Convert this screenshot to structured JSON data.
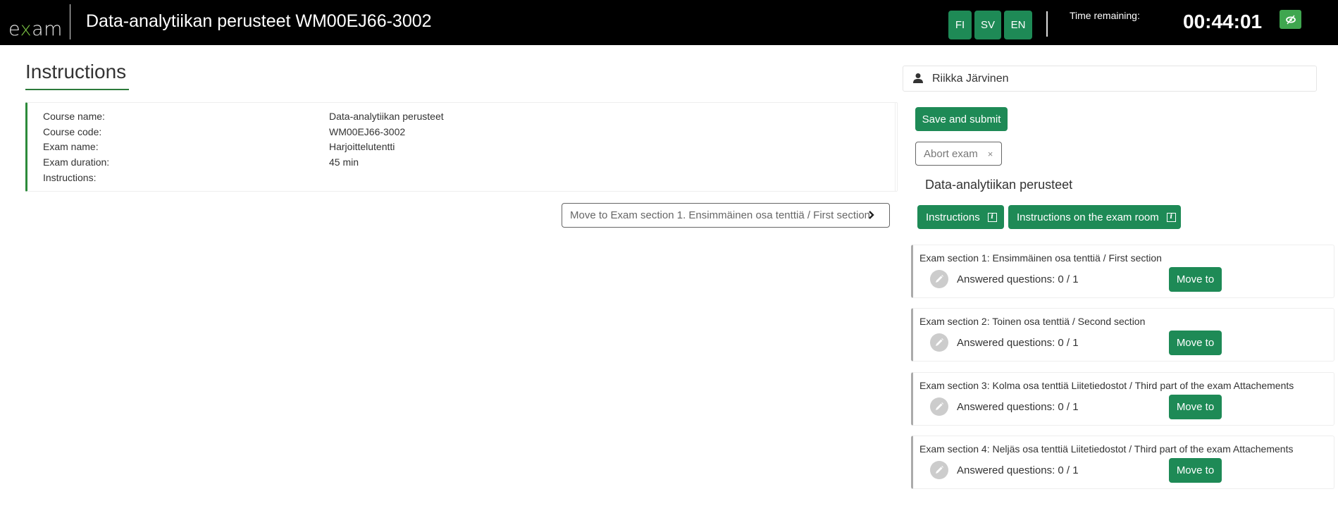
{
  "header": {
    "logo_prefix": "e",
    "logo_x": "x",
    "logo_suffix": "am",
    "title": "Data-analytiikan perusteet WM00EJ66-3002",
    "languages": [
      {
        "code": "FI"
      },
      {
        "code": "SV"
      },
      {
        "code": "EN"
      }
    ],
    "time_label": "Time remaining:",
    "time_value": "00:44:01",
    "hide_timer_icon": "eye-slash-icon"
  },
  "colors": {
    "primary_green": "#1e8a56",
    "header_bg": "#000000",
    "accent_green": "#2c8a3a",
    "toggle_green": "#3fa64f"
  },
  "main": {
    "page_title": "Instructions",
    "info": [
      {
        "label": "Course name:",
        "value": "Data-analytiikan perusteet"
      },
      {
        "label": "Course code:",
        "value": "WM00EJ66-3002"
      },
      {
        "label": "Exam name:",
        "value": "Harjoittelutentti"
      },
      {
        "label": "Exam duration:",
        "value": "45 min"
      },
      {
        "label": "Instructions:",
        "value": ""
      }
    ],
    "next_button": "Move to Exam section 1. Ensimmäinen osa tenttiä / First section"
  },
  "sidebar": {
    "user_name": "Riikka Järvinen",
    "save_submit": "Save and submit",
    "abort": "Abort exam",
    "abort_icon": "×",
    "course_name": "Data-analytiikan perusteet",
    "instructions_btn": "Instructions",
    "exam_room_btn": "Instructions on the exam room",
    "info_icon": "i",
    "sections": [
      {
        "title": "Exam section 1: Ensimmäinen osa tenttiä / First section",
        "answered": "Answered questions: 0 / 1",
        "button": "Move to"
      },
      {
        "title": "Exam section 2: Toinen osa tenttiä / Second section",
        "answered": "Answered questions: 0 / 1",
        "button": "Move to"
      },
      {
        "title": "Exam section 3: Kolma osa tenttiä Liitetiedostot / Third part of the exam Attachements",
        "answered": "Answered questions: 0 / 1",
        "button": "Move to"
      },
      {
        "title": "Exam section 4: Neljäs osa tenttiä Liitetiedostot / Third part of the exam Attachements",
        "answered": "Answered questions: 0 / 1",
        "button": "Move to"
      }
    ]
  }
}
